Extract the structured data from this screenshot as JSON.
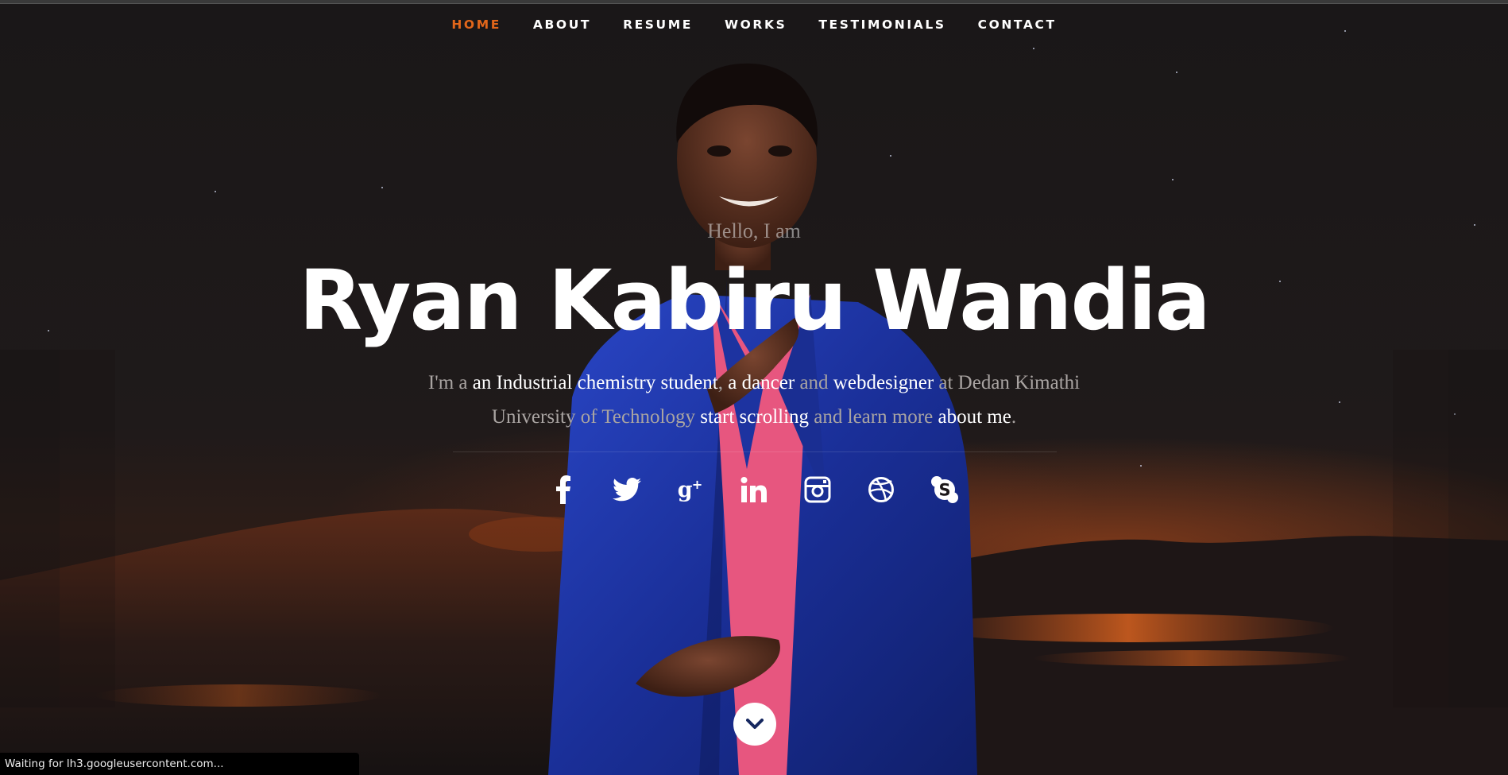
{
  "nav": {
    "items": [
      "HOME",
      "ABOUT",
      "RESUME",
      "WORKS",
      "TESTIMONIALS",
      "CONTACT"
    ],
    "active": "HOME",
    "active_color": "#e2661a"
  },
  "hero": {
    "greeting": "Hello, I am",
    "name": "Ryan Kabiru Wandia",
    "intro": {
      "p1": "I'm a ",
      "h1": "an Industrial chemistry student",
      "p2": ", ",
      "h2": "a dancer",
      "p3": " and ",
      "h3": "webdesigner",
      "p4": " at Dedan Kimathi University of Technology ",
      "h4": "start scrolling",
      "p5": " and learn more ",
      "h5": "about me",
      "p6": "."
    }
  },
  "social": [
    "facebook-icon",
    "twitter-icon",
    "google-plus-icon",
    "linkedin-icon",
    "instagram-icon",
    "dribbble-icon",
    "skype-icon"
  ],
  "scroll": {
    "icon": "chevron-down-icon"
  },
  "status": {
    "text": "Waiting for lh3.googleusercontent.com..."
  }
}
